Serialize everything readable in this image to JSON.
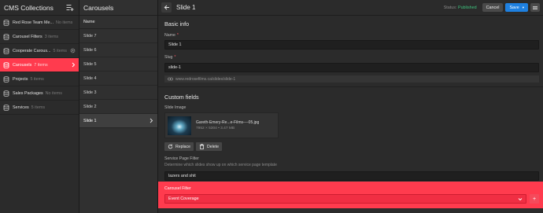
{
  "cms": {
    "title": "CMS Collections",
    "items": [
      {
        "name": "Red Rose Team Me...",
        "count": "No items"
      },
      {
        "name": "Carousel Filters",
        "count": "3 items"
      },
      {
        "name": "Cooperate Carous...",
        "count": "5 items"
      },
      {
        "name": "Carousels",
        "count": "7 items"
      },
      {
        "name": "Projects",
        "count": "5 items"
      },
      {
        "name": "Sales Packages",
        "count": "No items"
      },
      {
        "name": "Services",
        "count": "5 items"
      }
    ]
  },
  "carousels": {
    "title": "Carousels",
    "column_header": "Name",
    "items": [
      "Slide 7",
      "Slide 6",
      "Slide 5",
      "Slide 4",
      "Slide 3",
      "Slide 2",
      "Slide 1"
    ]
  },
  "editor": {
    "title": "Slide 1",
    "status_label": "Status:",
    "status_value": "Published",
    "cancel_label": "Cancel",
    "save_label": "Save",
    "basic_info": "Basic info",
    "name_label": "Name",
    "name_value": "Slide 1",
    "slug_label": "Slug",
    "slug_value": "slide-1",
    "url": "www.redrosefilms.ca/slides/slide-1",
    "custom_fields": "Custom fields",
    "slide_image_label": "Slide Image",
    "image_filename": "Gareth-Emery-Re...e-Films----05.jpg",
    "image_meta": "7952 × 5304 • 3.47 MB",
    "replace_label": "Replace",
    "delete_label": "Delete",
    "service_filter_label": "Service Page Filter",
    "service_filter_desc": "Determine which slides show up on which service page template",
    "service_filter_value": "lazers and shit",
    "carousel_filter_label": "Carousel Filter",
    "carousel_filter_value": "Event Coverage"
  },
  "colors": {
    "accent": "#ff3b4e",
    "save_blue": "#1e80e0",
    "published_green": "#3ec47e"
  }
}
